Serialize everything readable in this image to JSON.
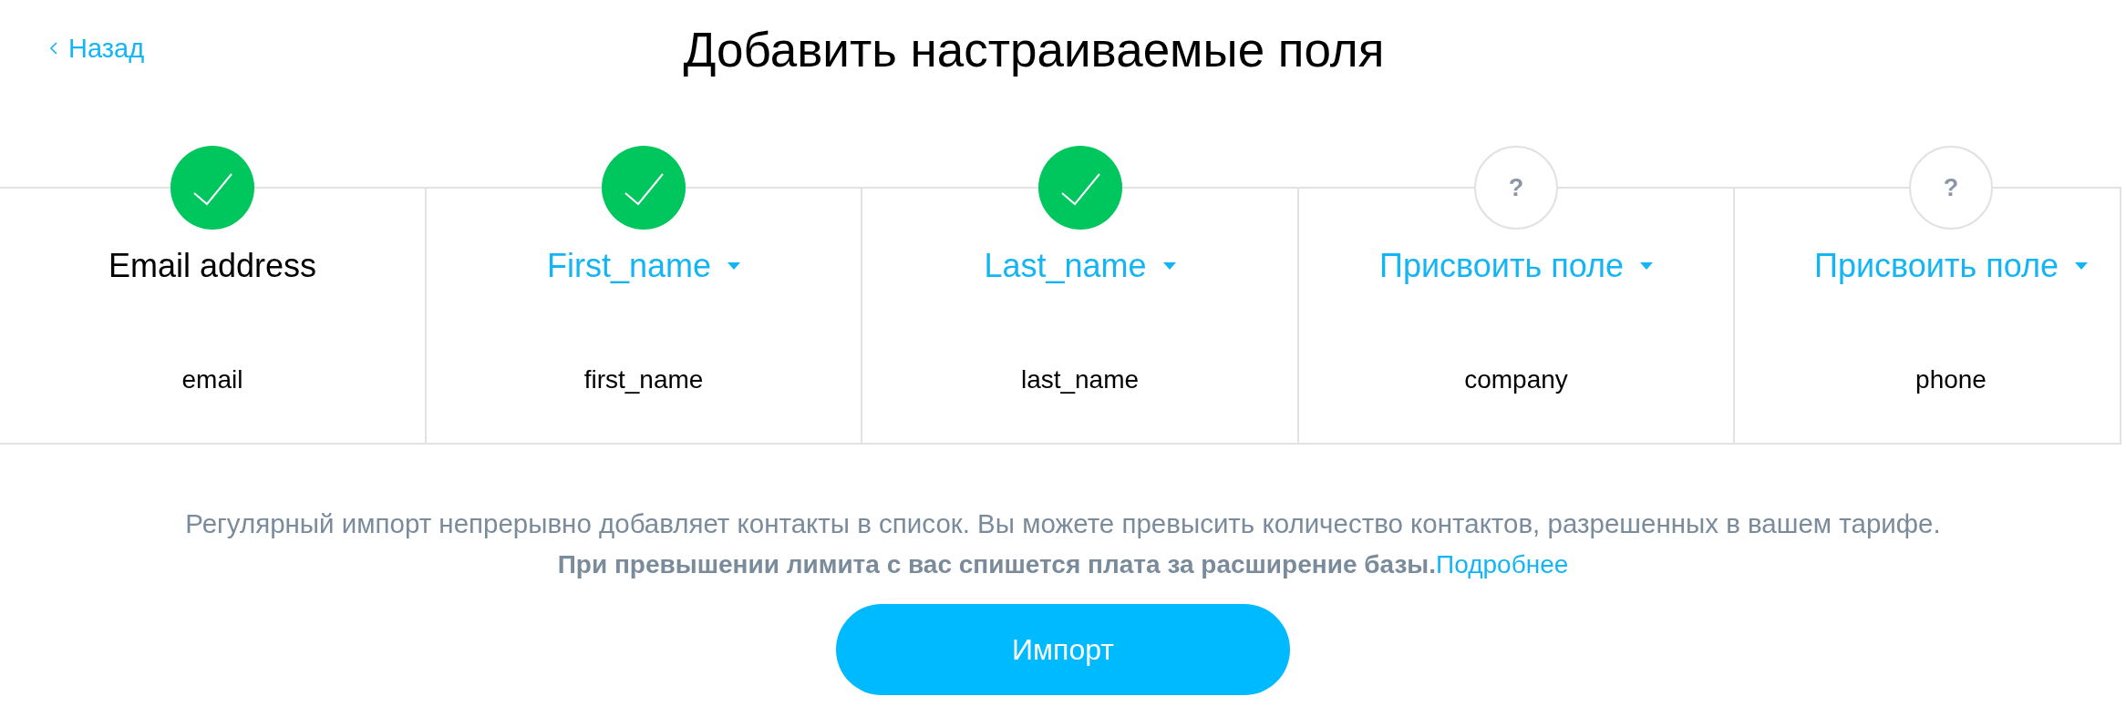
{
  "back_link": {
    "label": "Назад"
  },
  "title": "Добавить настраиваемые поля",
  "columns": [
    {
      "status": {
        "kind": "mapped"
      },
      "field": {
        "kind": "static",
        "label": "Email address"
      },
      "source": "email"
    },
    {
      "status": {
        "kind": "mapped"
      },
      "field": {
        "kind": "dropdown",
        "label": "First_name"
      },
      "source": "first_name"
    },
    {
      "status": {
        "kind": "mapped"
      },
      "field": {
        "kind": "dropdown",
        "label": "Last_name"
      },
      "source": "last_name"
    },
    {
      "status": {
        "kind": "unmapped",
        "symbol": "?"
      },
      "field": {
        "kind": "dropdown",
        "label": "Присвоить поле"
      },
      "source": "company"
    },
    {
      "status": {
        "kind": "unmapped",
        "symbol": "?"
      },
      "field": {
        "kind": "dropdown",
        "label": "Присвоить поле"
      },
      "source": "phone"
    }
  ],
  "notice": {
    "text": "Регулярный импорт непрерывно добавляет контакты в список. Вы можете превысить количество контактов, разрешенных в вашем тарифе.",
    "warning": "При превышении лимита с вас спишется плата за расширение базы.",
    "link": "Подробнее"
  },
  "buttons": [
    {
      "label": "Импорт"
    }
  ]
}
